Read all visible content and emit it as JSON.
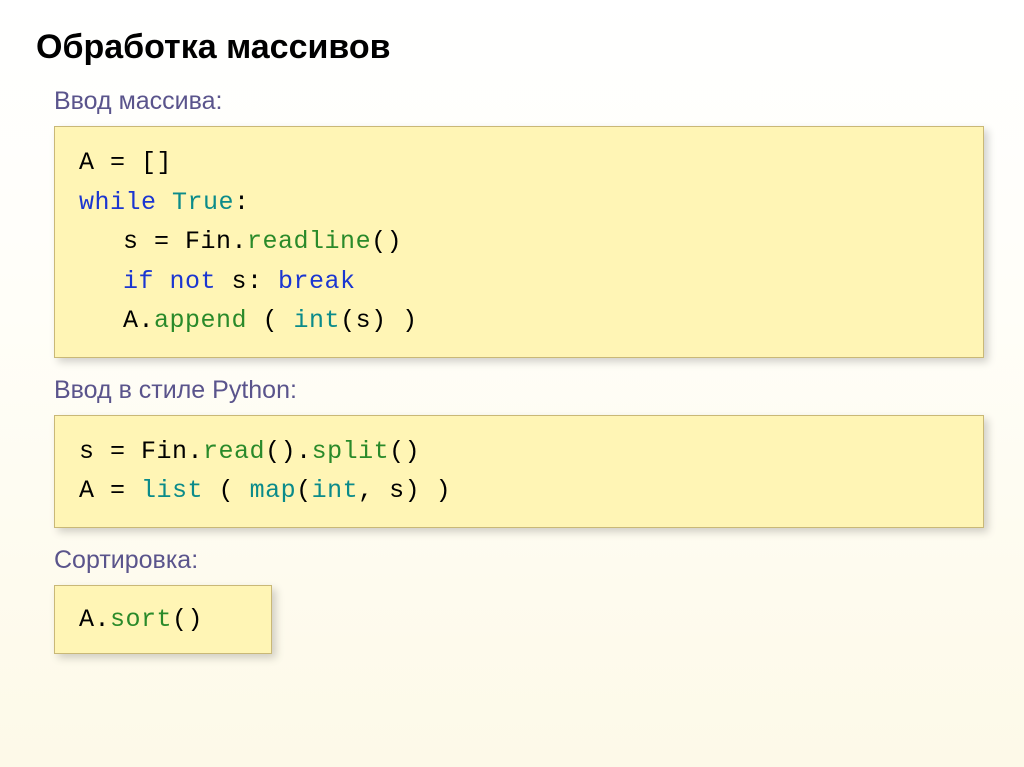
{
  "title": "Обработка массивов",
  "section1": {
    "heading": "Ввод массива:",
    "lines": {
      "l1_a": "A",
      "l1_b": " = []",
      "l2_a": "while",
      "l2_b": " True",
      "l2_c": ":",
      "l3_a": "s",
      "l3_b": " = Fin.",
      "l3_c": "readline",
      "l3_d": "()",
      "l4_a": "if not",
      "l4_b": " s: ",
      "l4_c": "break",
      "l5_a": "A.",
      "l5_b": "append",
      "l5_c": " ( ",
      "l5_d": "int",
      "l5_e": "(s) )"
    }
  },
  "section2": {
    "heading": "Ввод в стиле Python:",
    "lines": {
      "l1_a": "s",
      "l1_b": " = Fin.",
      "l1_c": "read",
      "l1_d": "().",
      "l1_e": "split",
      "l1_f": "()",
      "l2_a": "A",
      "l2_b": " = ",
      "l2_c": "list",
      "l2_d": " ( ",
      "l2_e": "map",
      "l2_f": "(",
      "l2_g": "int",
      "l2_h": ", s) )"
    }
  },
  "section3": {
    "heading": "Сортировка:",
    "lines": {
      "l1_a": "A.",
      "l1_b": "sort",
      "l1_c": "()"
    }
  }
}
